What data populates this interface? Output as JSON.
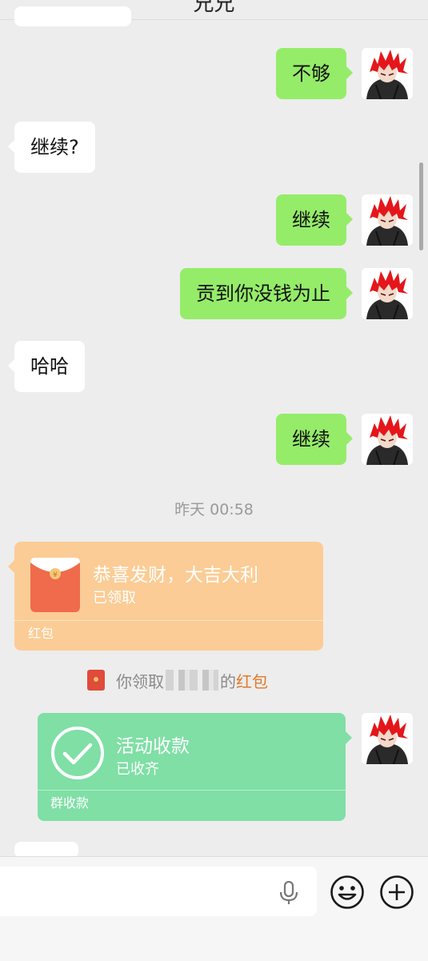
{
  "header": {
    "title": "兄兄"
  },
  "messages": [
    {
      "direction": "out",
      "text": "不够"
    },
    {
      "direction": "in",
      "text": "继续?"
    },
    {
      "direction": "out",
      "text": "继续"
    },
    {
      "direction": "out",
      "text": "贡到你没钱为止"
    },
    {
      "direction": "in",
      "text": "哈哈"
    },
    {
      "direction": "out",
      "text": "继续"
    }
  ],
  "timestamp": "昨天 00:58",
  "red_packet": {
    "title": "恭喜发财，大吉大利",
    "status": "已领取",
    "label": "红包"
  },
  "system_notice": {
    "prefix": "你领取",
    "suffix": "的",
    "link": "红包"
  },
  "group_collect": {
    "title": "活动收款",
    "status": "已收齐",
    "label": "群收款"
  },
  "input_bar": {
    "value": "",
    "icons": [
      "microphone-icon",
      "emoji-icon",
      "plus-icon"
    ]
  },
  "colors": {
    "outgoing_bubble": "#95ec69",
    "incoming_bubble": "#ffffff",
    "red_packet": "#fbcc95",
    "group_collect": "#7fdfa5",
    "link": "#e07a2b"
  }
}
